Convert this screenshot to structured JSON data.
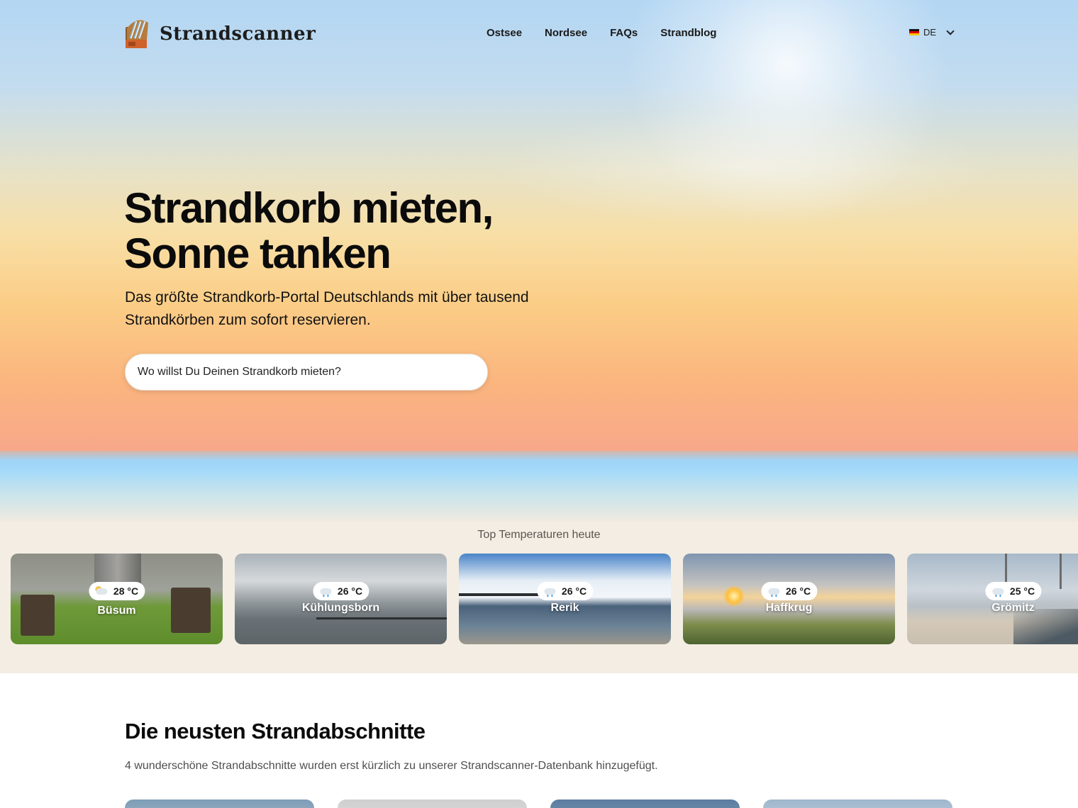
{
  "brand": {
    "name": "Strandscanner"
  },
  "nav": {
    "items": [
      {
        "label": "Ostsee"
      },
      {
        "label": "Nordsee"
      },
      {
        "label": "FAQs"
      },
      {
        "label": "Strandblog"
      }
    ],
    "language": {
      "code": "DE",
      "icon": "german-flag-icon"
    }
  },
  "hero": {
    "title_line1": "Strandkorb mieten,",
    "title_line2": "Sonne tanken",
    "subtitle": "Das größte Strandkorb-Portal Deutschlands mit über tausend Strandkörben zum sofort reservieren.",
    "search_placeholder": "Wo willst Du Deinen Strandkorb mieten?"
  },
  "top_temperatures": {
    "title": "Top Temperaturen heute",
    "cards": [
      {
        "name": "Büsum",
        "temp": "28 °C",
        "weather_icon": "partly-cloudy-icon"
      },
      {
        "name": "Kühlungsborn",
        "temp": "26 °C",
        "weather_icon": "rain-icon"
      },
      {
        "name": "Rerik",
        "temp": "26 °C",
        "weather_icon": "rain-icon"
      },
      {
        "name": "Haffkrug",
        "temp": "26 °C",
        "weather_icon": "rain-icon"
      },
      {
        "name": "Grömitz",
        "temp": "25 °C",
        "weather_icon": "rain-icon"
      }
    ]
  },
  "newest": {
    "title": "Die neusten Strandabschnitte",
    "description": "4 wunderschöne Strandabschnitte wurden erst kürzlich zu unserer Strandscanner-Datenbank hinzugefügt."
  },
  "colors": {
    "hero_top": "#b3d6f3",
    "hero_bottom": "#f8a78a",
    "strip_bg": "#f3ede3"
  }
}
